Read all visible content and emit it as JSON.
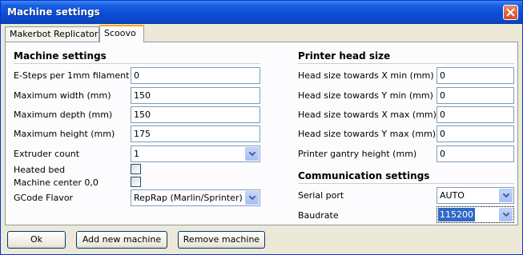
{
  "window": {
    "title": "Machine settings"
  },
  "tabs": [
    {
      "label": "Makerbot Replicator"
    },
    {
      "label": "Scoovo"
    }
  ],
  "machine_settings": {
    "heading": "Machine settings",
    "e_steps": {
      "label": "E-Steps per 1mm filament",
      "value": "0"
    },
    "max_width": {
      "label": "Maximum width (mm)",
      "value": "150"
    },
    "max_depth": {
      "label": "Maximum depth (mm)",
      "value": "150"
    },
    "max_height": {
      "label": "Maximum height (mm)",
      "value": "175"
    },
    "extruder_count": {
      "label": "Extruder count",
      "value": "1"
    },
    "heated_bed": {
      "label": "Heated bed",
      "checked": false
    },
    "machine_center": {
      "label": "Machine center 0,0",
      "checked": false
    },
    "gcode_flavor": {
      "label": "GCode Flavor",
      "value": "RepRap (Marlin/Sprinter)"
    }
  },
  "printer_head": {
    "heading": "Printer head size",
    "x_min": {
      "label": "Head size towards X min (mm)",
      "value": "0"
    },
    "y_min": {
      "label": "Head size towards Y min (mm)",
      "value": "0"
    },
    "x_max": {
      "label": "Head size towards X max (mm)",
      "value": "0"
    },
    "y_max": {
      "label": "Head size towards Y max (mm)",
      "value": "0"
    },
    "gantry_height": {
      "label": "Printer gantry height (mm)",
      "value": "0"
    }
  },
  "communication": {
    "heading": "Communication settings",
    "serial_port": {
      "label": "Serial port",
      "value": "AUTO"
    },
    "baudrate": {
      "label": "Baudrate",
      "value": "115200"
    }
  },
  "buttons": {
    "ok": "Ok",
    "add_machine": "Add new machine",
    "remove_machine": "Remove machine"
  }
}
